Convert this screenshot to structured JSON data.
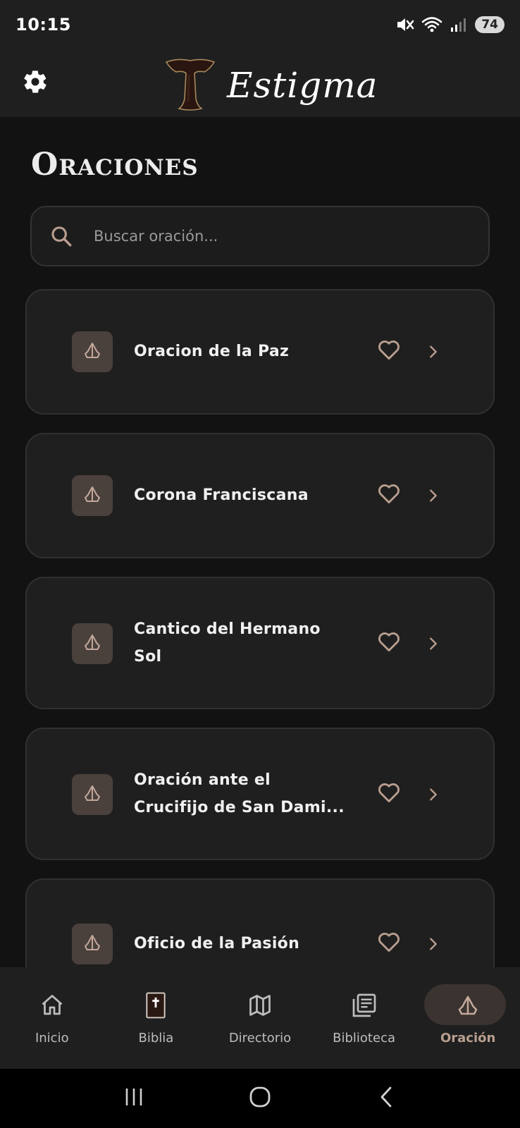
{
  "status_bar": {
    "time": "10:15",
    "battery": "74",
    "icons": [
      "mute-icon",
      "wifi-icon",
      "signal-icon"
    ]
  },
  "header": {
    "app_title": "Estigma",
    "settings_icon": "gear-icon",
    "logo": "tau-cross-logo"
  },
  "page": {
    "title": "Oraciones"
  },
  "search": {
    "placeholder": "Buscar oración...",
    "value": ""
  },
  "prayers": [
    {
      "name": "Oracion de la Paz"
    },
    {
      "name": "Corona Franciscana"
    },
    {
      "name": "Cantico del Hermano Sol"
    },
    {
      "name": "Oración ante el Crucifijo de San Dami..."
    },
    {
      "name": "Oficio de la Pasión"
    }
  ],
  "bottom_nav": {
    "items": [
      {
        "label": "Inicio",
        "icon": "home-icon"
      },
      {
        "label": "Biblia",
        "icon": "bible-icon"
      },
      {
        "label": "Directorio",
        "icon": "map-icon"
      },
      {
        "label": "Biblioteca",
        "icon": "library-icon"
      },
      {
        "label": "Oración",
        "icon": "praying-hands-icon"
      }
    ],
    "active": "Oración"
  },
  "colors": {
    "background": "#121212",
    "surface": "#1f1f1f",
    "accent": "#b99e8f",
    "icon_tile": "#4a403c"
  }
}
